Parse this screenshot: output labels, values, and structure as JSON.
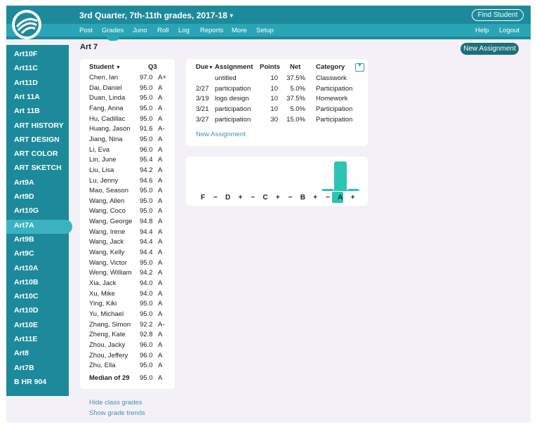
{
  "header": {
    "term": "3rd Quarter, 7th-11th grades, 2017-18",
    "find_student": "Find Student"
  },
  "nav": {
    "items": [
      "Post",
      "Grades",
      "Juno",
      "Roll",
      "Log",
      "Reports",
      "More",
      "Setup"
    ],
    "active": "Grades",
    "help": "Help",
    "logout": "Logout"
  },
  "sidebar": {
    "items": [
      "Art10F",
      "Art11C",
      "Art11D",
      "Art 11A",
      "Art 11B",
      "ART HISTORY",
      "ART DESIGN",
      "ART COLOR",
      "ART SKETCH",
      "Art9A",
      "Art9D",
      "Art10G",
      "Art7A",
      "Art9B",
      "Art9C",
      "Art10A",
      "Art10B",
      "Art10C",
      "Art10D",
      "Art10E",
      "Art11E",
      "Art8",
      "Art7B",
      "B HR 904"
    ],
    "active": "Art7A"
  },
  "page": {
    "title": "Art 7",
    "new_assignment_button": "New Assignment"
  },
  "students": {
    "header_student": "Student",
    "header_q3": "Q3",
    "rows": [
      {
        "name": "Chen, Ian",
        "score": "97.0",
        "grade": "A+"
      },
      {
        "name": "Dai, Daniel",
        "score": "95.0",
        "grade": "A"
      },
      {
        "name": "Duan, Linda",
        "score": "95.0",
        "grade": "A"
      },
      {
        "name": "Fang, Anna",
        "score": "95.0",
        "grade": "A"
      },
      {
        "name": "Hu, Cadillac",
        "score": "95.0",
        "grade": "A"
      },
      {
        "name": "Huang, Jason",
        "score": "91.6",
        "grade": "A-"
      },
      {
        "name": "Jiang, Nina",
        "score": "95.0",
        "grade": "A"
      },
      {
        "name": "Li, Eva",
        "score": "96.0",
        "grade": "A"
      },
      {
        "name": "Lin, June",
        "score": "95.4",
        "grade": "A"
      },
      {
        "name": "Liu, Lisa",
        "score": "94.2",
        "grade": "A"
      },
      {
        "name": "Lu, Jenny",
        "score": "94.6",
        "grade": "A"
      },
      {
        "name": "Mao, Season",
        "score": "95.0",
        "grade": "A"
      },
      {
        "name": "Wang, Allen",
        "score": "95.0",
        "grade": "A"
      },
      {
        "name": "Wang, Coco",
        "score": "95.0",
        "grade": "A"
      },
      {
        "name": "Wang, George",
        "score": "94.8",
        "grade": "A"
      },
      {
        "name": "Wang, Irene",
        "score": "94.4",
        "grade": "A"
      },
      {
        "name": "Wang, Jack",
        "score": "94.4",
        "grade": "A"
      },
      {
        "name": "Wang, Kelly",
        "score": "94.4",
        "grade": "A"
      },
      {
        "name": "Wang, Victor",
        "score": "95.0",
        "grade": "A"
      },
      {
        "name": "Weng, William",
        "score": "94.2",
        "grade": "A"
      },
      {
        "name": "Xia, Jack",
        "score": "94.0",
        "grade": "A"
      },
      {
        "name": "Xu, Mike",
        "score": "94.0",
        "grade": "A"
      },
      {
        "name": "Ying, Kiki",
        "score": "95.0",
        "grade": "A"
      },
      {
        "name": "Yu, Michael",
        "score": "95.0",
        "grade": "A"
      },
      {
        "name": "Zhang, Simon",
        "score": "92.2",
        "grade": "A-"
      },
      {
        "name": "Zheng, Kate",
        "score": "92.8",
        "grade": "A"
      },
      {
        "name": "Zhou, Jacky",
        "score": "96.0",
        "grade": "A"
      },
      {
        "name": "Zhou, Jeffery",
        "score": "96.0",
        "grade": "A"
      },
      {
        "name": "Zhu, Ella",
        "score": "95.0",
        "grade": "A"
      }
    ],
    "median_label": "Median of 29",
    "median_score": "95.0",
    "median_grade": "A"
  },
  "assignments": {
    "headers": {
      "due": "Due",
      "assignment": "Assignment",
      "points": "Points",
      "net": "Net",
      "category": "Category"
    },
    "rows": [
      {
        "due": "",
        "assignment": "untitled",
        "points": "10",
        "net": "37.5%",
        "category": "Classwork"
      },
      {
        "due": "2/27",
        "assignment": "participation",
        "points": "10",
        "net": "5.0%",
        "category": "Participation"
      },
      {
        "due": "3/19",
        "assignment": "logo design",
        "points": "10",
        "net": "37.5%",
        "category": "Homework"
      },
      {
        "due": "3/21",
        "assignment": "participation",
        "points": "10",
        "net": "5.0%",
        "category": "Participation"
      },
      {
        "due": "3/27",
        "assignment": "participation",
        "points": "30",
        "net": "15.0%",
        "category": "Participation"
      }
    ],
    "new_assignment_link": "New Assignment"
  },
  "distribution": {
    "labels": [
      "F",
      "−",
      "D",
      "+",
      "−",
      "C",
      "+",
      "−",
      "B",
      "+",
      "−",
      "A",
      "+"
    ],
    "counts": [
      0,
      0,
      0,
      0,
      0,
      0,
      0,
      0,
      0,
      0,
      2,
      26,
      1
    ],
    "highlight": "A",
    "bar_color": "#2cc4b4"
  },
  "footer": {
    "hide_class_grades": "Hide class grades",
    "show_grade_trends": "Show grade trends"
  },
  "colors": {
    "header": "#1d8a9b",
    "nav": "#2aa5b5",
    "accent": "#2cc4b4",
    "background": "#f3f1f7"
  }
}
